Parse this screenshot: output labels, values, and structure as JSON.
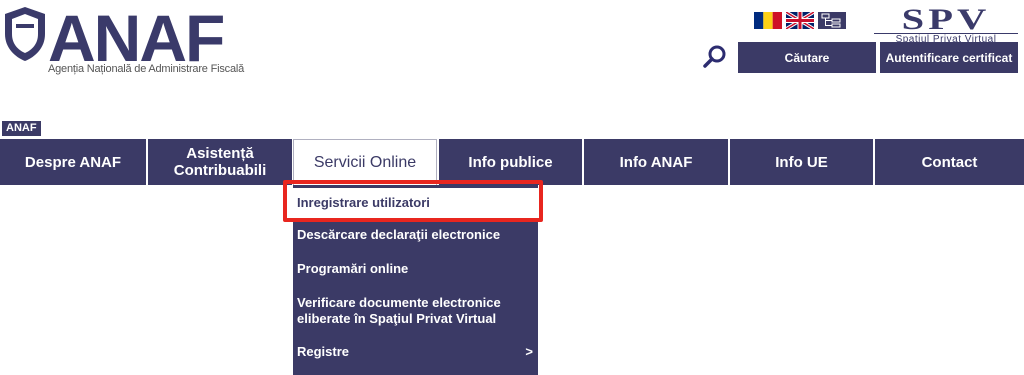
{
  "header": {
    "logo_text": "ANAF",
    "logo_subtitle": "Agenția Națională de Administrare Fiscală",
    "spv_logo_text": "SPV",
    "spv_subtitle": "Spațiul Privat Virtual",
    "languages": [
      {
        "icon": "romania-flag-icon"
      },
      {
        "icon": "uk-flag-icon"
      },
      {
        "icon": "sitemap-icon"
      }
    ],
    "search_label": "Căutare",
    "auth_label": "Autentificare certificat"
  },
  "breadcrumb": {
    "label": "ANAF"
  },
  "nav": {
    "items": [
      {
        "label": "Despre ANAF"
      },
      {
        "label": "Asistență Contribuabili"
      },
      {
        "label": "Servicii Online",
        "active": true
      },
      {
        "label": "Info publice"
      },
      {
        "label": "Info ANAF"
      },
      {
        "label": "Info UE"
      },
      {
        "label": "Contact"
      }
    ]
  },
  "dropdown": {
    "items": [
      {
        "label": "Inregistrare utilizatori",
        "selected": true
      },
      {
        "label": "Descărcare declaraţii electronice"
      },
      {
        "label": "Programări online"
      },
      {
        "label": "Verificare documente electronice eliberate în Spaţiul Privat Virtual"
      },
      {
        "label": "Registre",
        "arrow": ">"
      }
    ]
  },
  "colors": {
    "primary": "#3b3a66",
    "highlight": "#e8261f",
    "text_on_primary": "#ffffff"
  }
}
